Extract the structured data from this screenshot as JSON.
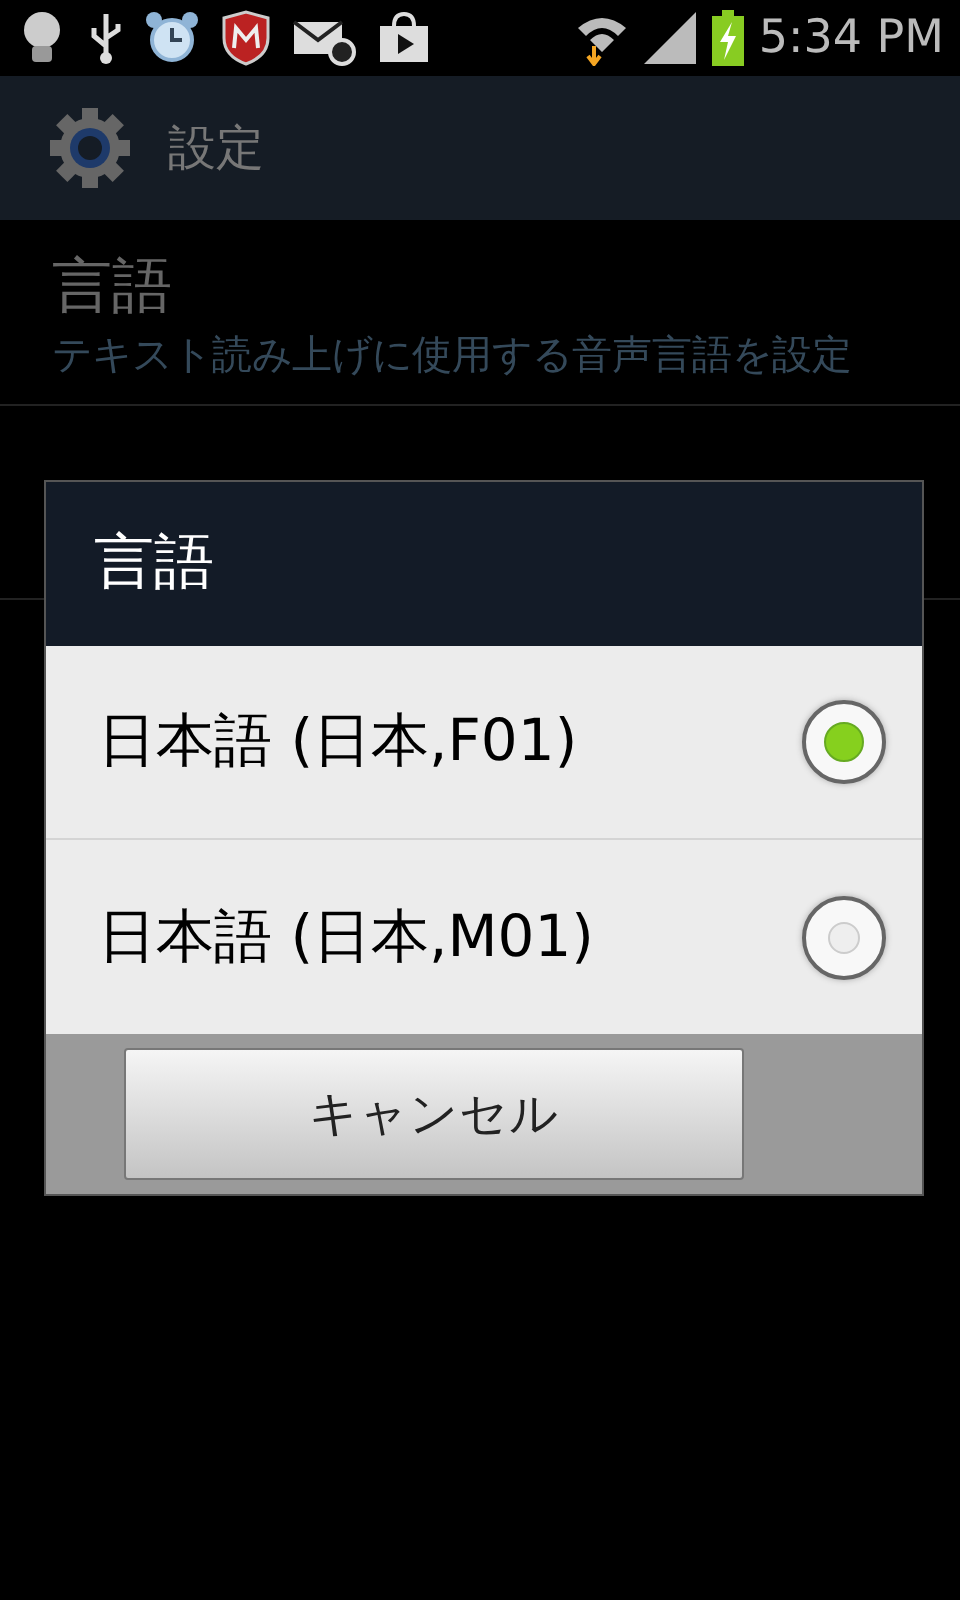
{
  "status_bar": {
    "time": "5:34 PM"
  },
  "action_bar": {
    "title": "設定"
  },
  "settings": [
    {
      "title": "言語",
      "summary": "テキスト読み上げに使用する音声言語を設定"
    }
  ],
  "dialog": {
    "title": "言語",
    "options": [
      {
        "label": "日本語 (日本,F01)",
        "selected": true
      },
      {
        "label": "日本語 (日本,M01)",
        "selected": false
      }
    ],
    "buttons": [
      "キャンセル"
    ]
  }
}
